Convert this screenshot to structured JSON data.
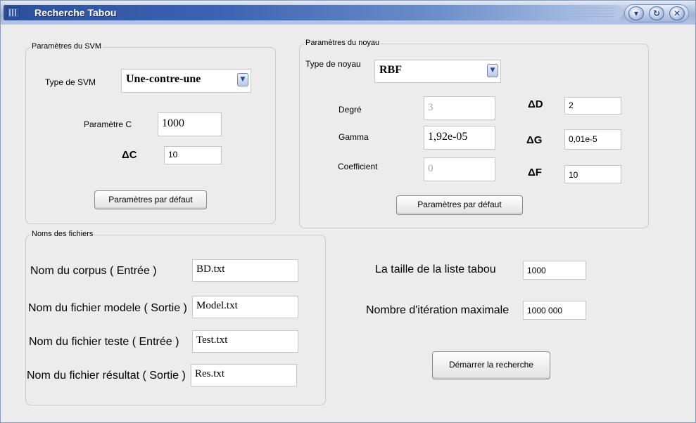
{
  "window": {
    "title": "Recherche Tabou",
    "controls": {
      "minimize_icon": "circle-down-arrow-icon",
      "restore_icon": "circle-restore-icon",
      "close_icon": "circle-x-icon"
    }
  },
  "colors": {
    "titlebar_blue": "#2b4f9b",
    "window_bg": "#ececec",
    "disabled_text": "#a8a8a8"
  },
  "svm": {
    "legend": "Paramètres du SVM",
    "type_label": "Type de SVM",
    "type_value": "Une-contre-une",
    "c_label": "Paramètre C",
    "c_value": "1000",
    "delta_c_label": "ΔC",
    "delta_c_value": "10",
    "default_button": "Paramètres par défaut"
  },
  "kernel": {
    "legend": "Paramètres du noyau",
    "type_label": "Type de noyau",
    "type_value": "RBF",
    "degree_label": "Degré",
    "degree_value": "3",
    "gamma_label": "Gamma",
    "gamma_value": "1,92e-05",
    "coef_label": "Coefficient",
    "coef_value": "0",
    "delta_d_label": "ΔD",
    "delta_d_value": "2",
    "delta_g_label": "ΔG",
    "delta_g_value": "0,01e-5",
    "delta_f_label": "ΔF",
    "delta_f_value": "10",
    "default_button": "Paramètres par défaut"
  },
  "files": {
    "legend": "Noms des fichiers",
    "corpus_label": "Nom du corpus ( Entrée )",
    "corpus_value": "BD.txt",
    "model_label": "Nom du fichier modele ( Sortie )",
    "model_value": "Model.txt",
    "test_label": "Nom du fichier teste  ( Entrée )",
    "test_value": "Test.txt",
    "result_label": "Nom du fichier résultat  ( Sortie )",
    "result_value": "Res.txt"
  },
  "search": {
    "tabu_size_label": "La taille de la liste tabou",
    "tabu_size_value": "1000",
    "max_iter_label": "Nombre d'itération maximale",
    "max_iter_value": "1000 000",
    "start_button": "Démarrer la recherche"
  }
}
